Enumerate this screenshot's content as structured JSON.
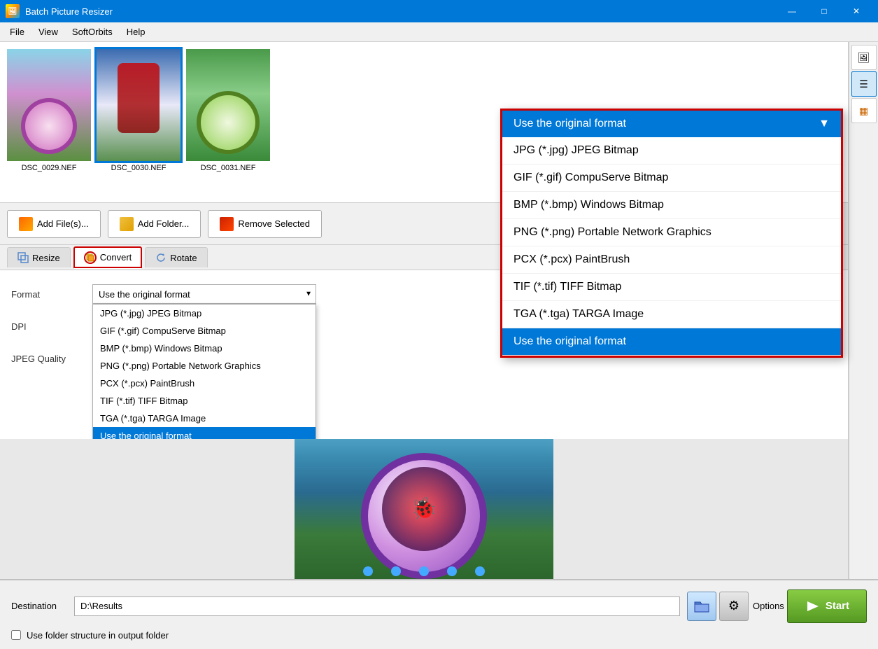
{
  "window": {
    "title": "Batch Picture Resizer",
    "controls": {
      "minimize": "—",
      "maximize": "□",
      "close": "✕"
    }
  },
  "menu": {
    "items": [
      "File",
      "View",
      "SoftOrbits",
      "Help"
    ]
  },
  "image_strip": {
    "images": [
      {
        "name": "DSC_0029.NEF",
        "selected": false
      },
      {
        "name": "DSC_0030.NEF",
        "selected": true
      },
      {
        "name": "DSC_0031.NEF",
        "selected": false
      }
    ]
  },
  "toolbar": {
    "add_files_label": "Add File(s)...",
    "add_folder_label": "Add Folder...",
    "remove_selected_label": "Remove Selected"
  },
  "tabs": {
    "resize_label": "Resize",
    "convert_label": "Convert",
    "rotate_label": "Rotate"
  },
  "format_section": {
    "label": "Format",
    "current_value": "Use the original format",
    "options": [
      "JPG (*.jpg) JPEG Bitmap",
      "GIF (*.gif) CompuServe Bitmap",
      "BMP (*.bmp) Windows Bitmap",
      "PNG (*.png) Portable Network Graphics",
      "PCX (*.pcx) PaintBrush",
      "TIF (*.tif) TIFF Bitmap",
      "TGA (*.tga) TARGA Image",
      "Use the original format"
    ],
    "selected_index": 7
  },
  "dpi_section": {
    "label": "DPI",
    "value": ""
  },
  "jpeg_quality_section": {
    "label": "JPEG Quality",
    "value": ""
  },
  "big_dropdown": {
    "header": "Use the original format",
    "options": [
      "JPG (*.jpg) JPEG Bitmap",
      "GIF (*.gif) CompuServe Bitmap",
      "BMP (*.bmp) Windows Bitmap",
      "PNG (*.png) Portable Network Graphics",
      "PCX (*.pcx) PaintBrush",
      "TIF (*.tif) TIFF Bitmap",
      "TGA (*.tga) TARGA Image",
      "Use the original format"
    ],
    "selected_index": 7
  },
  "destination": {
    "label": "Destination",
    "value": "D:\\Results",
    "placeholder": "D:\\Results"
  },
  "footer": {
    "checkbox_label": "Use folder structure in output folder",
    "options_label": "Options",
    "start_label": "Start"
  },
  "sidebar": {
    "buttons": [
      "🖼",
      "☰",
      "▦"
    ]
  }
}
